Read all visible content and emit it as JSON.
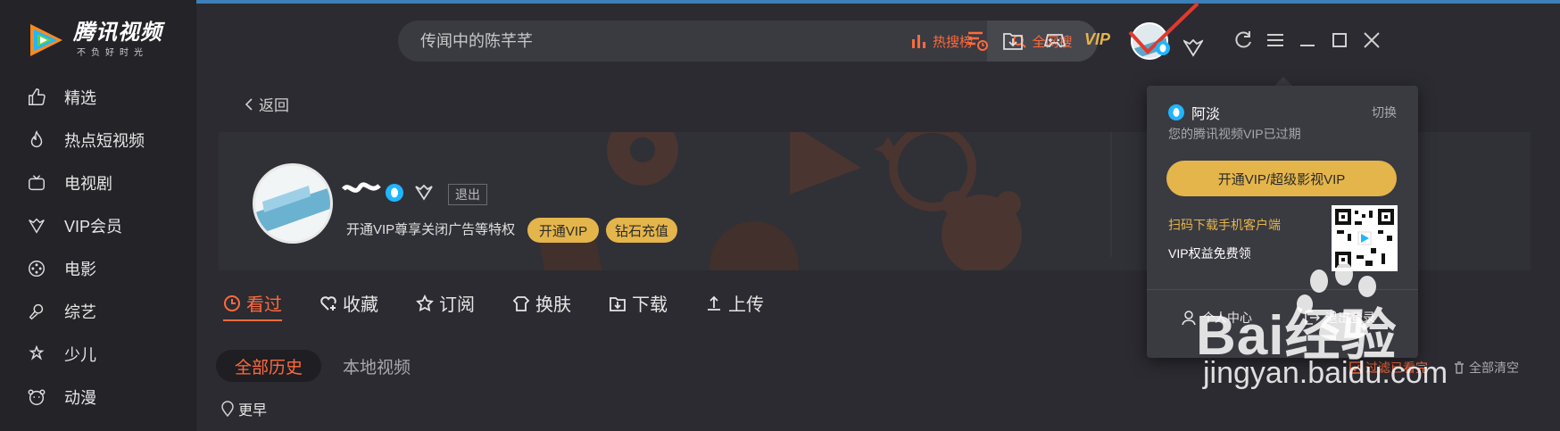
{
  "app": {
    "logo_name": "腾讯视频",
    "logo_slogan": "不负好时光"
  },
  "sidebar": {
    "items": [
      {
        "label": "精选",
        "icon": "thumbs-up-icon"
      },
      {
        "label": "热点短视频",
        "icon": "flame-icon"
      },
      {
        "label": "电视剧",
        "icon": "tv-icon"
      },
      {
        "label": "VIP会员",
        "icon": "vip-crown-icon"
      },
      {
        "label": "电影",
        "icon": "film-reel-icon"
      },
      {
        "label": "综艺",
        "icon": "microphone-icon"
      },
      {
        "label": "少儿",
        "icon": "child-icon"
      },
      {
        "label": "动漫",
        "icon": "bear-face-icon"
      }
    ]
  },
  "search": {
    "placeholder": "传闻中的陈芊芊",
    "hot_label": "热搜榜",
    "all_label": "全网搜"
  },
  "topbar": {
    "vip_label": "VIP"
  },
  "profile": {
    "back_label": "返回",
    "logout_label": "退出",
    "privilege_text": "开通VIP尊享关闭广告等特权",
    "open_vip": "开通VIP",
    "diamond_recharge": "钻石充值"
  },
  "tabs": [
    {
      "label": "看过",
      "icon": "clock-icon"
    },
    {
      "label": "收藏",
      "icon": "heart-plus-icon"
    },
    {
      "label": "订阅",
      "icon": "star-icon"
    },
    {
      "label": "换肤",
      "icon": "shirt-icon"
    },
    {
      "label": "下载",
      "icon": "download-icon"
    },
    {
      "label": "上传",
      "icon": "upload-icon"
    }
  ],
  "history": {
    "subtab_all": "全部历史",
    "subtab_local": "本地视频",
    "group_label": "更早",
    "filter_label": "过滤已看完",
    "clear_label": "全部清空"
  },
  "popover": {
    "username": "阿淡",
    "switch_label": "切换",
    "expired_text": "您的腾讯视频VIP已过期",
    "open_button": "开通VIP/超级影视VIP",
    "scan_text": "扫码下载手机客户端",
    "rights_text": "VIP权益免费领",
    "center_label": "个人中心",
    "logout_label": "退出登录"
  },
  "watermark": {
    "brand": "Bai经验",
    "url": "jingyan.baidu.com"
  },
  "colors": {
    "accent": "#ff6a3c",
    "gold": "#e4b54b",
    "sidebar_bg": "#232328",
    "main_bg": "#2b2b31"
  }
}
